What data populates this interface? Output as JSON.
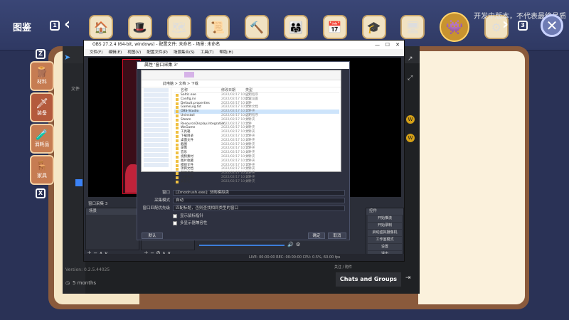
{
  "game": {
    "title": "图鉴",
    "page_prev": "1",
    "page_next": "3",
    "notice": "开发中版本，不代表最终品质",
    "close": "✕",
    "categories": [
      "🏠",
      "🎩",
      "🗺",
      "📜",
      "🔨",
      "👨‍👩‍👧",
      "📅",
      "🎓",
      "🖥",
      "👾",
      "⚙"
    ],
    "side_tabs": [
      {
        "label": "材料",
        "icon": "🪵"
      },
      {
        "label": "装备",
        "icon": "🗡"
      },
      {
        "label": "消耗品",
        "icon": "🧪"
      },
      {
        "label": "家具",
        "icon": "🪑"
      }
    ],
    "side_top_key": "Z",
    "side_bottom_key": "X"
  },
  "bg_app": {
    "version": "Version: 0.2.5.44025",
    "ago": "5 months",
    "chats_button": "Chats and Groups",
    "file_label": "文件",
    "stat_label": "关注 / 附件",
    "no_preview": "无预览"
  },
  "obs": {
    "title": "OBS 27.2.4 (64-bit, windows) - 配置文件: 未命名 - 场景: 未命名",
    "menus": [
      "文件(F)",
      "编辑(E)",
      "视图(V)",
      "配置文件(P)",
      "场景集合(S)",
      "工具(T)",
      "帮助(H)"
    ],
    "scene_header": "场景",
    "source_header": "来源",
    "source_label": "窗口采集 3",
    "controls_header": "控件",
    "controls": [
      "开始推流",
      "开始录制",
      "启动虚拟摄像机",
      "工作室模式",
      "设置",
      "退出"
    ],
    "status": "LIVE: 00:00:00    REC: 00:00:00    CPU: 0.5%, 60.00 fps"
  },
  "dialog": {
    "title": "属性 '窗口采集 3'",
    "window_label": "窗口",
    "window_value": "[Zmodrush.exe]: 牙刷模拟类",
    "capture_label": "采集模式",
    "capture_value": "自动",
    "priority_label": "窗口匹配优先级",
    "priority_value": "匹配标题，否则查找相同类型的窗口",
    "show_cursor": "显示鼠标指针",
    "multi_adapter": "多显示器兼容性",
    "defaults": "默认",
    "ok": "确定",
    "cancel": "取消"
  },
  "explorer": {
    "address": "此电脑 > 文档 > 下载",
    "col_name": "名称",
    "col_date": "修改日期",
    "col_type": "类型",
    "files": [
      {
        "n": "Saltic.exe",
        "d": "2022/02/17 10:25",
        "t": "应用程序"
      },
      {
        "n": "Config.ini",
        "d": "2022/02/17 10:25",
        "t": "配置设置"
      },
      {
        "n": "Default.properties",
        "d": "2022/02/17 10:25",
        "t": "文件"
      },
      {
        "n": "GameLog.txt",
        "d": "2022/02/17 10:25",
        "t": "文本文档"
      },
      {
        "n": "OBS-Studio",
        "d": "2022/02/17 10:25",
        "t": "文件夹"
      },
      {
        "n": "Uninstall",
        "d": "2022/02/17 10:25",
        "t": "应用程序"
      },
      {
        "n": "Steam",
        "d": "2022/02/17 10:25",
        "t": "文件夹"
      },
      {
        "n": "ResourceDisplay.Integration",
        "d": "2022/02/17 10:25",
        "t": "文件"
      },
      {
        "n": "WeGame",
        "d": "2022/02/17 10:25",
        "t": "文件夹"
      },
      {
        "n": "工具箱",
        "d": "2022/02/17 10:25",
        "t": "文件夹"
      },
      {
        "n": "下载目录",
        "d": "2022/02/17 10:25",
        "t": "文件夹"
      },
      {
        "n": "桌面文件",
        "d": "2022/02/17 10:25",
        "t": "文件夹"
      },
      {
        "n": "截图",
        "d": "2022/02/17 10:25",
        "t": "文件夹"
      },
      {
        "n": "录像",
        "d": "2022/02/17 10:25",
        "t": "文件夹"
      },
      {
        "n": "音乐",
        "d": "2022/02/17 10:25",
        "t": "文件夹"
      },
      {
        "n": "视频素材",
        "d": "2022/02/17 10:25",
        "t": "文件夹"
      },
      {
        "n": "图片收藏",
        "d": "2022/02/17 10:25",
        "t": "文件夹"
      },
      {
        "n": "模组文件",
        "d": "2022/02/17 10:25",
        "t": "文件夹"
      },
      {
        "n": "项目文档",
        "d": "2022/02/17 10:25",
        "t": "文件夹"
      },
      {
        "n": "游戏存档",
        "d": "2022/02/17 10:25",
        "t": "文件夹"
      },
      {
        "n": "设置备份",
        "d": "2022/02/17 10:25",
        "t": "文件夹"
      },
      {
        "n": "安装包",
        "d": "2022/02/17 10:25",
        "t": "文件夹"
      }
    ]
  },
  "colors": {
    "accent": "#c8932f",
    "panel": "#2f323c",
    "page": "#fbf1dc"
  }
}
